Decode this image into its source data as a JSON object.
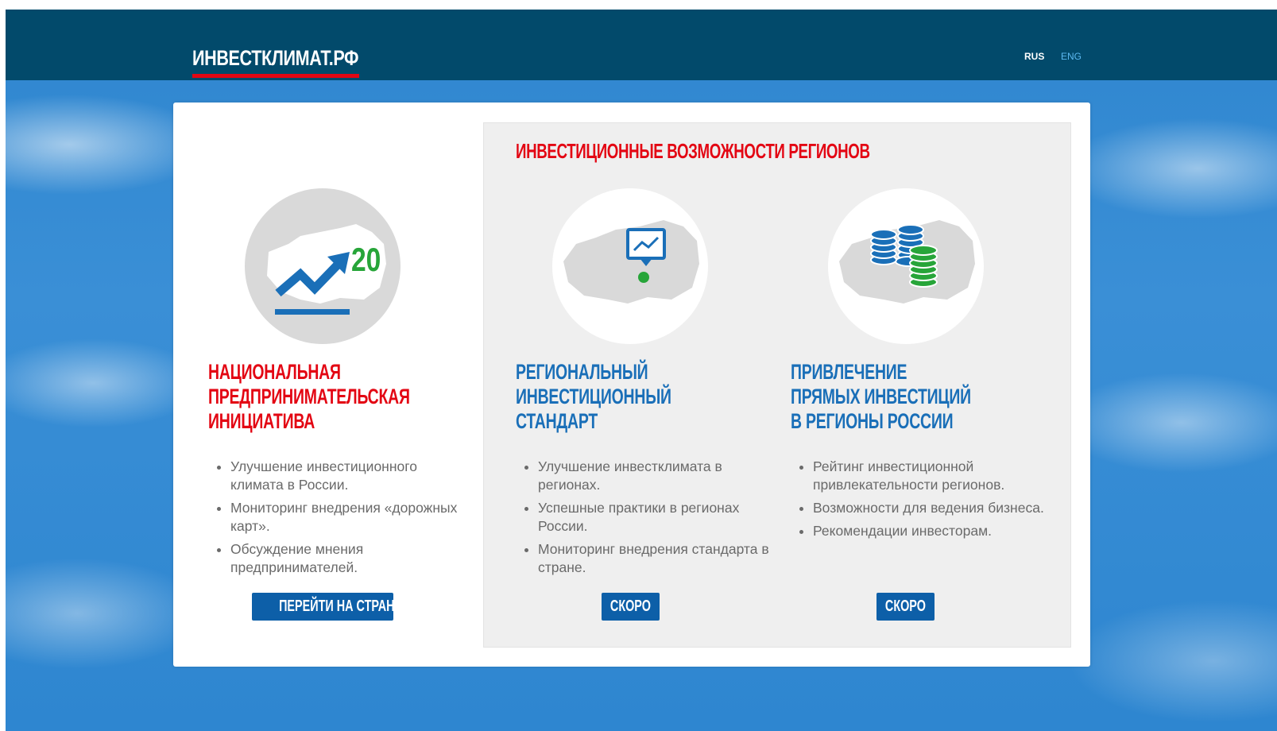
{
  "header": {
    "logo": "ИНВЕСТКЛИМАТ.РФ",
    "lang_rus": "RUS",
    "lang_eng": "ENG"
  },
  "section_title": "ИНВЕСТИЦИОННЫЕ ВОЗМОЖНОСТИ РЕГИОНОВ",
  "columns": [
    {
      "icon": "growth-chart-icon",
      "icon_number": "20",
      "title_lines": [
        "НАЦИОНАЛЬНАЯ",
        "ПРЕДПРИНИМАТЕЛЬСКАЯ",
        "ИНИЦИАТИВА"
      ],
      "bullets": [
        "Улучшение инвестиционного климата в России.",
        "Мониторинг внедрения «дорожных карт».",
        "Обсуждение мнения предпринимателей."
      ],
      "button": "ПЕРЕЙТИ НА СТРАНИЦУ"
    },
    {
      "icon": "map-presentation-icon",
      "title_lines": [
        "РЕГИОНАЛЬНЫЙ",
        "ИНВЕСТИЦИОННЫЙ",
        "СТАНДАРТ"
      ],
      "bullets": [
        "Улучшение инвестклимата в регионах.",
        "Успешные практики в регионах России.",
        "Мониторинг внедрения стандарта в стране."
      ],
      "button": "СКОРО"
    },
    {
      "icon": "coin-stacks-icon",
      "title_lines": [
        "ПРИВЛЕЧЕНИЕ",
        "ПРЯМЫХ ИНВЕСТИЦИЙ",
        "В РЕГИОНЫ РОССИИ"
      ],
      "bullets": [
        "Рейтинг инвестиционной привлекательности регионов.",
        "Возможности для ведения бизнеса.",
        "Рекомендации инвесторам."
      ],
      "button": "СКОРО"
    }
  ],
  "colors": {
    "header_bg": "#024a6b",
    "accent_red": "#e30613",
    "title_blue": "#1a6fb8",
    "button_blue": "#0d5fa8",
    "icon_green": "#27a539"
  }
}
